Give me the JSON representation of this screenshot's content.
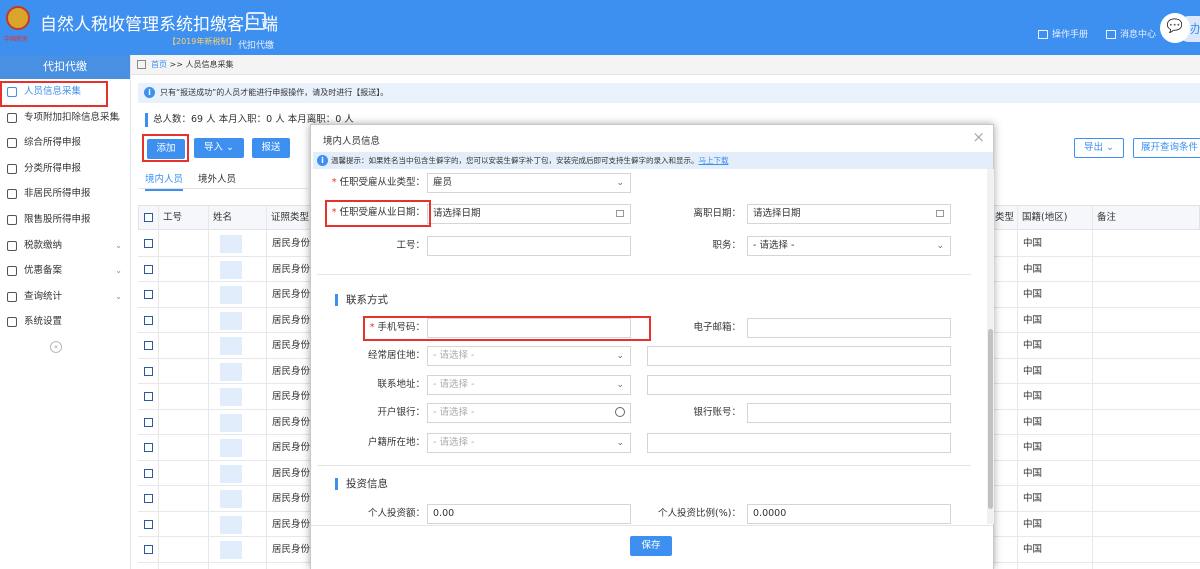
{
  "header": {
    "app_title": "自然人税收管理系统扣缴客户端",
    "version": "【2019年新税制】",
    "mode": "代扣代缴",
    "manual": "操作手册",
    "messages": "消息中心",
    "user": "办",
    "emblem_text": "中国税务"
  },
  "sidebar": {
    "title": "代扣代缴",
    "items": [
      {
        "label": "人员信息采集",
        "icon": "person-icon",
        "chevron": ""
      },
      {
        "label": "专项附加扣除信息采集",
        "icon": "grid-icon",
        "chevron": "⌄"
      },
      {
        "label": "综合所得申报",
        "icon": "layers-icon",
        "chevron": ""
      },
      {
        "label": "分类所得申报",
        "icon": "pie-icon",
        "chevron": ""
      },
      {
        "label": "非居民所得申报",
        "icon": "user-icon",
        "chevron": ""
      },
      {
        "label": "限售股所得申报",
        "icon": "chart-icon",
        "chevron": ""
      },
      {
        "label": "税款缴纳",
        "icon": "folder-icon",
        "chevron": "⌄"
      },
      {
        "label": "优惠备案",
        "icon": "doc-icon",
        "chevron": "⌄"
      },
      {
        "label": "查询统计",
        "icon": "search-list-icon",
        "chevron": "⌄"
      },
      {
        "label": "系统设置",
        "icon": "gear-icon",
        "chevron": ""
      }
    ],
    "collapse": "«"
  },
  "breadcrumb": {
    "home": "首页",
    "sep": " >> ",
    "current": "人员信息采集"
  },
  "notice": "只有“报送成功”的人员才能进行申报操作，请及时进行【报送】。",
  "stats": "总人数：69 人   本月入职：0 人   本月离职：0 人",
  "toolbar": {
    "add": "添加",
    "import": "导入",
    "import_arrow": "⌄",
    "submit": "报送",
    "export": "导出",
    "export_arrow": "⌄",
    "expand": "展开查询条件"
  },
  "tabs": [
    "境内人员",
    "境外人员"
  ],
  "table": {
    "headers": [
      "工号",
      "姓名",
      "证照类型"
    ],
    "right_headers": [
      "类型",
      "国籍(地区)",
      "备注"
    ],
    "id_type": "居民身份",
    "nationality": "中国",
    "rows": 13
  },
  "dialog": {
    "title": "境内人员信息",
    "close": "×",
    "tip": "温馨提示：如果姓名当中包含生僻字的，您可以安装生僻字补丁包，安装完成后即可支持生僻字的录入和显示。",
    "tip_link": "马上下载",
    "employ_type_label": "任职受雇从业类型：",
    "employ_type_value": "雇员",
    "employ_date_label": "任职受雇从业日期：",
    "employ_date_placeholder": "请选择日期",
    "leave_date_label": "离职日期：",
    "leave_date_placeholder": "请选择日期",
    "job_no_label": "工号：",
    "position_label": "职务：",
    "position_value": "- 请选择 -",
    "contact_section": "联系方式",
    "phone_label": "手机号码：",
    "email_label": "电子邮箱：",
    "residence_label": "经常居住地：",
    "residence_value": "- 请选择 -",
    "address_label": "联系地址：",
    "address_value": "- 请选择 -",
    "bank_label": "开户银行：",
    "bank_value": "- 请选择 -",
    "account_label": "银行账号：",
    "household_label": "户籍所在地：",
    "household_value": "- 请选择 -",
    "invest_section": "投资信息",
    "invest_amount_label": "个人投资额：",
    "invest_amount_value": "0.00",
    "invest_ratio_label": "个人投资比例(%)：",
    "invest_ratio_value": "0.0000",
    "save": "保存"
  },
  "colors": {
    "primary": "#3d8ff0",
    "highlight": "#e5322b"
  }
}
